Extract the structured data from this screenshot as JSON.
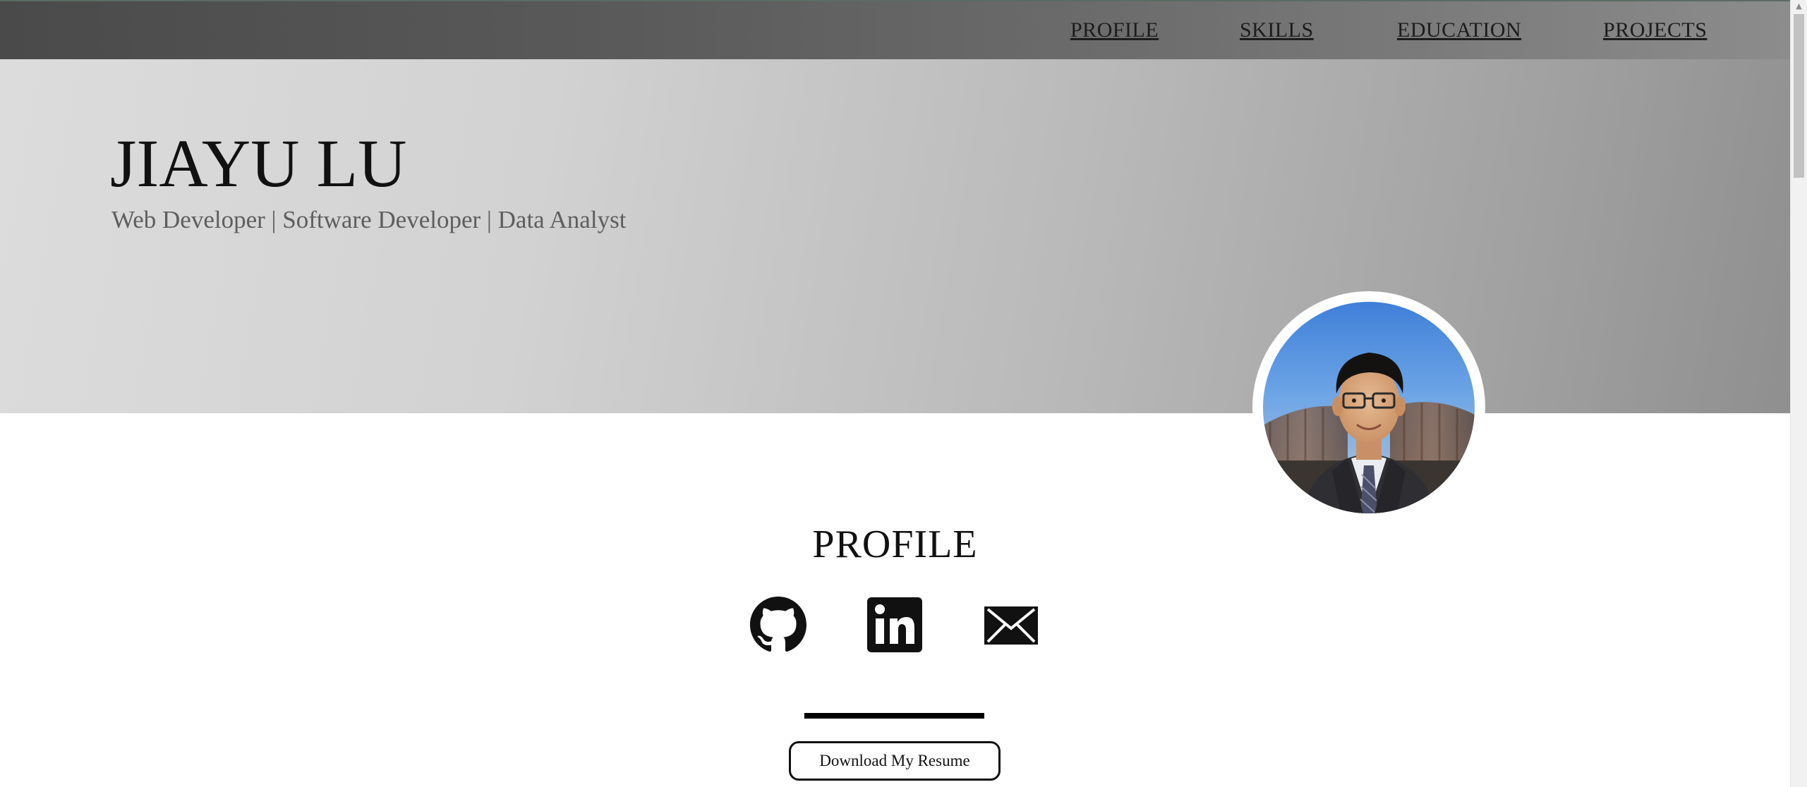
{
  "nav": {
    "items": [
      {
        "label": "PROFILE"
      },
      {
        "label": "SKILLS"
      },
      {
        "label": "EDUCATION"
      },
      {
        "label": "PROJECTS"
      }
    ]
  },
  "hero": {
    "name": "JIAYU LU",
    "subtitle": "Web Developer | Software Developer | Data Analyst"
  },
  "profile": {
    "title": "PROFILE",
    "social_icons": [
      "github-icon",
      "linkedin-icon",
      "mail-icon"
    ],
    "resume_button": "Download My Resume"
  },
  "scrollbar": {
    "up_arrow": "▲"
  },
  "colors": {
    "nav_gradient_start": "#4a4a4a",
    "nav_gradient_end": "#8c8c8c",
    "hero_gradient_start": "#dcdcdc",
    "hero_gradient_end": "#8f8f8f",
    "text_primary": "#111111",
    "text_subtitle": "#5e5e5e"
  }
}
